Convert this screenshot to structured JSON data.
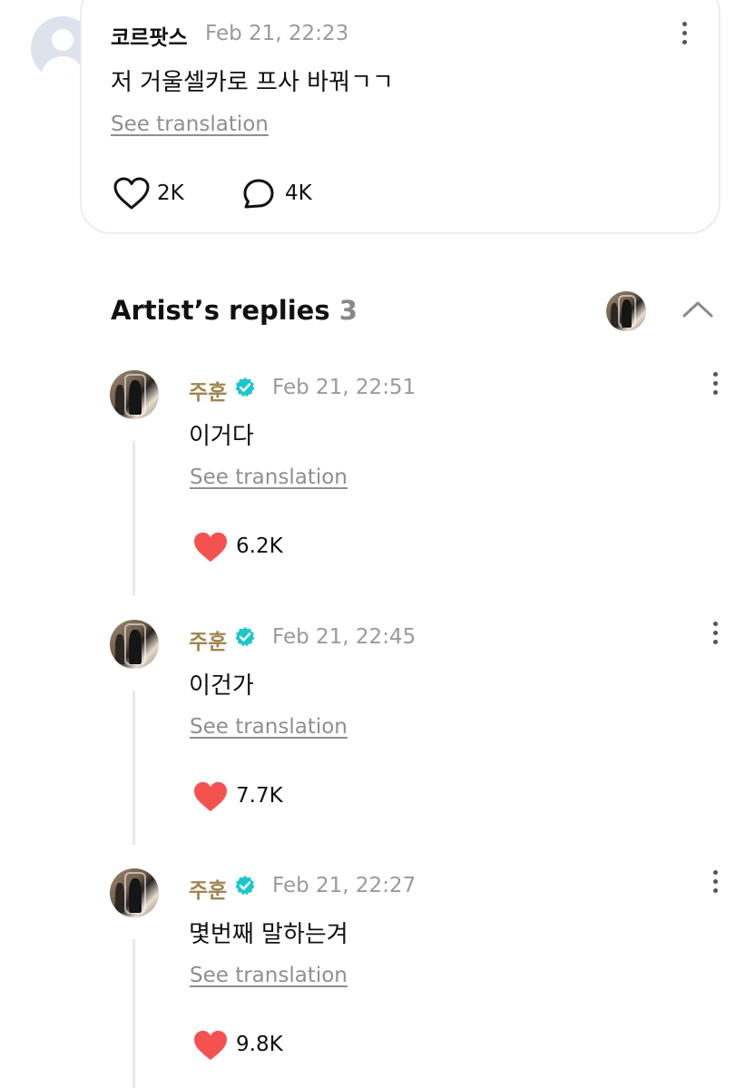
{
  "post": {
    "author": "코르팟스",
    "time": "Feb 21, 22:23",
    "text": "저 거울셀카로 프사 바꿔ㄱㄱ",
    "see_translation": "See translation",
    "likes": "2K",
    "comments": "4K",
    "avatar_icon": "default-user-avatar-icon"
  },
  "artist_replies": {
    "title": "Artist’s replies",
    "count": "3"
  },
  "replies": [
    {
      "name": "주훈",
      "time": "Feb 21, 22:51",
      "text": "이거다",
      "see_translation": "See translation",
      "likes": "6.2K"
    },
    {
      "name": "주훈",
      "time": "Feb 21, 22:45",
      "text": "이건가",
      "see_translation": "See translation",
      "likes": "7.7K"
    },
    {
      "name": "주훈",
      "time": "Feb 21, 22:27",
      "text": "몇번째 말하는겨",
      "see_translation": "See translation",
      "likes": "9.8K"
    }
  ],
  "colors": {
    "artist_name": "#a08550",
    "verified_badge": "#1cc7c9",
    "liked_heart": "#f4524f",
    "muted_text": "#9a9a9a"
  }
}
